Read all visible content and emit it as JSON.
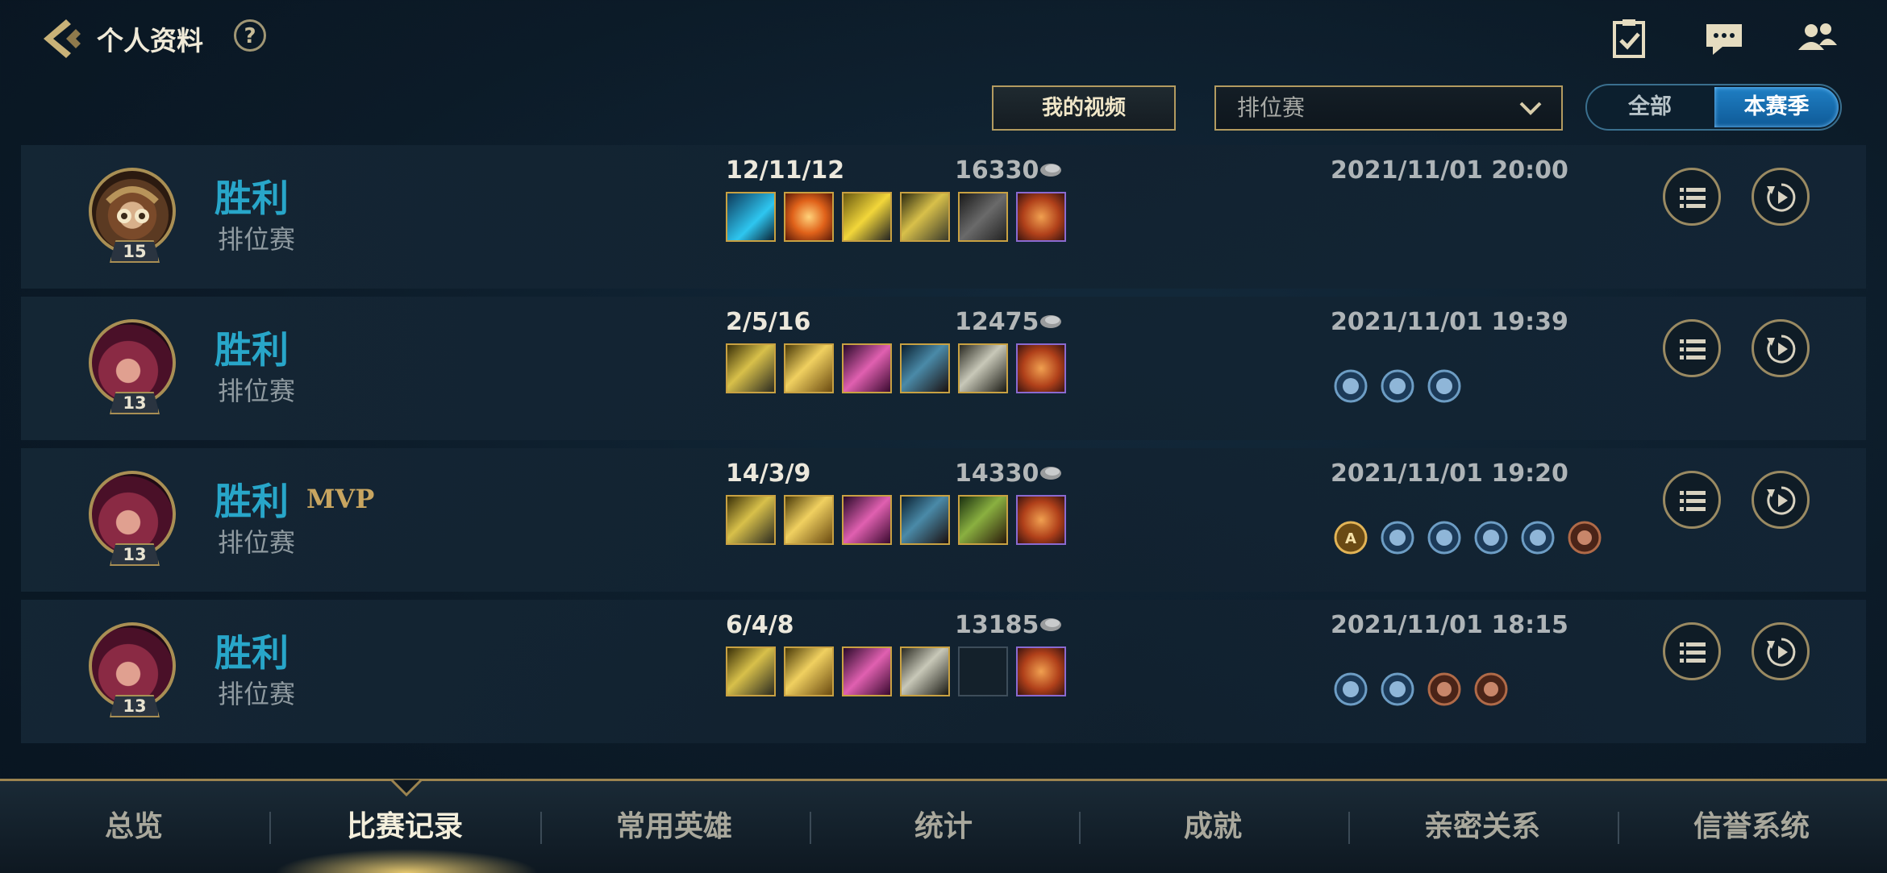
{
  "header": {
    "title": "个人资料",
    "help_label": "?"
  },
  "filters": {
    "video_button": "我的视频",
    "mode_select": "排位赛",
    "toggle_all": "全部",
    "toggle_season": "本赛季"
  },
  "matches": [
    {
      "level": "15",
      "result": "胜利",
      "mvp": "",
      "mode": "排位赛",
      "kda": "12/11/12",
      "gold": "16330",
      "time": "2021/11/01 20:00"
    },
    {
      "level": "13",
      "result": "胜利",
      "mvp": "",
      "mode": "排位赛",
      "kda": "2/5/16",
      "gold": "12475",
      "time": "2021/11/01 19:39"
    },
    {
      "level": "13",
      "result": "胜利",
      "mvp": "MVP",
      "mode": "排位赛",
      "kda": "14/3/9",
      "gold": "14330",
      "time": "2021/11/01 19:20"
    },
    {
      "level": "13",
      "result": "胜利",
      "mvp": "",
      "mode": "排位赛",
      "kda": "6/4/8",
      "gold": "13185",
      "time": "2021/11/01 18:15"
    }
  ],
  "nav": {
    "tabs": [
      "总览",
      "比赛记录",
      "常用英雄",
      "统计",
      "成就",
      "亲密关系",
      "信誉系统"
    ],
    "active_index": 1
  },
  "colors": {
    "victory": "#28a6c9",
    "gold_border": "#b39b60",
    "toggle_active": "#1f7fc4"
  },
  "icons": {
    "back": "back-chevron-icon",
    "help": "help-icon",
    "task": "task-checklist-icon",
    "chat": "chat-bubble-icon",
    "friends": "friends-icon",
    "gold": "gold-coin-icon",
    "detail": "list-icon",
    "replay": "replay-icon"
  }
}
